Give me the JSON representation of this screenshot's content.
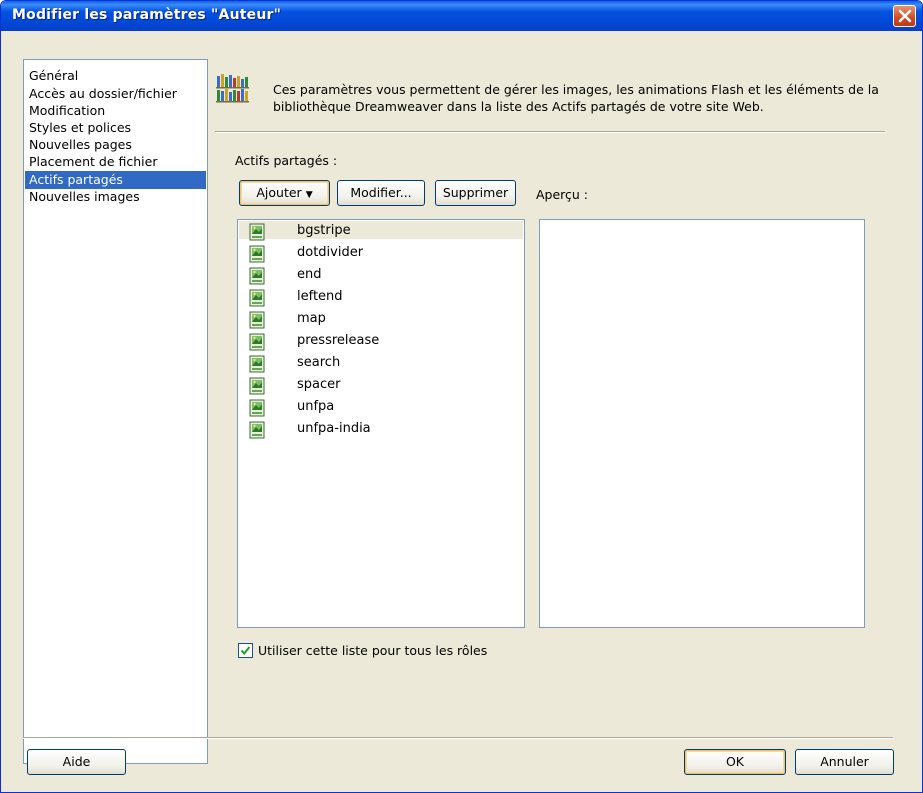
{
  "window": {
    "title": "Modifier les paramètres \"Auteur\"",
    "close_icon": "close-icon"
  },
  "sidebar": {
    "items": [
      {
        "label": "Général",
        "selected": false
      },
      {
        "label": "Accès au dossier/fichier",
        "selected": false
      },
      {
        "label": "Modification",
        "selected": false
      },
      {
        "label": "Styles et polices",
        "selected": false
      },
      {
        "label": "Nouvelles pages",
        "selected": false
      },
      {
        "label": "Placement de fichier",
        "selected": false
      },
      {
        "label": "Actifs partagés",
        "selected": true
      },
      {
        "label": "Nouvelles images",
        "selected": false
      }
    ]
  },
  "header": {
    "icon": "library-icon",
    "description": "Ces paramètres vous permettent de gérer les images, les animations Flash et les éléments de la bibliothèque Dreamweaver dans la liste des Actifs partagés de votre site Web."
  },
  "shared_assets": {
    "section_label": "Actifs partagés :",
    "add_button": "Ajouter",
    "edit_button": "Modifier...",
    "delete_button": "Supprimer",
    "preview_label": "Aperçu :",
    "items": [
      "bgstripe",
      "dotdivider",
      "end",
      "leftend",
      "map",
      "pressrelease",
      "search",
      "spacer",
      "unfpa",
      "unfpa-india"
    ],
    "item_icon": "image-file-icon"
  },
  "options": {
    "use_for_all_roles_label": "Utiliser cette liste pour tous les rôles",
    "use_for_all_roles_checked": true
  },
  "footer": {
    "help_button": "Aide",
    "ok_button": "OK",
    "cancel_button": "Annuler"
  },
  "colors": {
    "title_bar": "#0553e0",
    "selection": "#316ac5",
    "dialog_bg": "#ece9d8"
  }
}
